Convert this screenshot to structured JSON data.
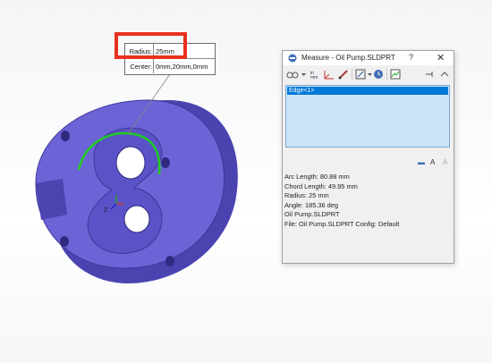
{
  "callout": {
    "radius_label": "Radius:",
    "radius_value": "25mm",
    "center_label": "Center:",
    "center_value": "0mm,20mm,0mm"
  },
  "measure": {
    "title": "Measure - Oil Pump.SLDPRT",
    "help": "?",
    "close": "✕",
    "selection": [
      "Edge<1>"
    ],
    "results": [
      "Arc Length: 80.88 mm",
      "Chord Length: 49.95 mm",
      "Radius: 25 mm",
      "Angle: 185.36 deg",
      "Oil Pump.SLDPRT",
      "File: Oil Pump.SLDPRT Config: Default"
    ]
  },
  "triad": {
    "axis_label": "Z"
  },
  "colors": {
    "part": "#6b63d6",
    "edge_highlight": "#22cc22",
    "callout_highlight": "#e8321e",
    "selection": "#0078d7"
  }
}
